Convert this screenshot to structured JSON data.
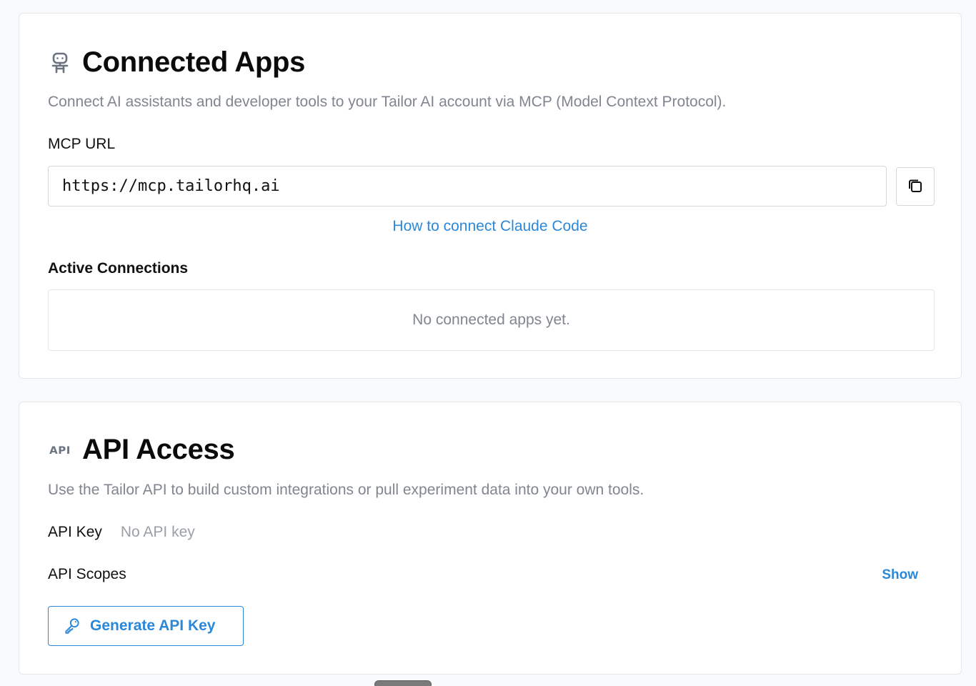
{
  "connected_apps": {
    "icon": "robot-icon",
    "title": "Connected Apps",
    "subtitle": "Connect AI assistants and developer tools to your Tailor AI account via MCP (Model Context Protocol).",
    "mcp_url_label": "MCP URL",
    "mcp_url_value": "https://mcp.tailorhq.ai",
    "copy_icon": "copy-icon",
    "help_link": "How to connect Claude Code",
    "active_connections_label": "Active Connections",
    "empty_state": "No connected apps yet."
  },
  "api_access": {
    "icon_text": "API",
    "title": "API Access",
    "subtitle": "Use the Tailor API to build custom integrations or pull experiment data into your own tools.",
    "api_key_label": "API Key",
    "api_key_value": "No API key",
    "api_scopes_label": "API Scopes",
    "scopes_toggle": "Show",
    "generate_button": "Generate API Key",
    "generate_icon": "key-icon"
  },
  "colors": {
    "accent": "#2b88d8",
    "muted_text": "#80868f",
    "border": "#e5e7eb",
    "background": "#f9fafb"
  }
}
